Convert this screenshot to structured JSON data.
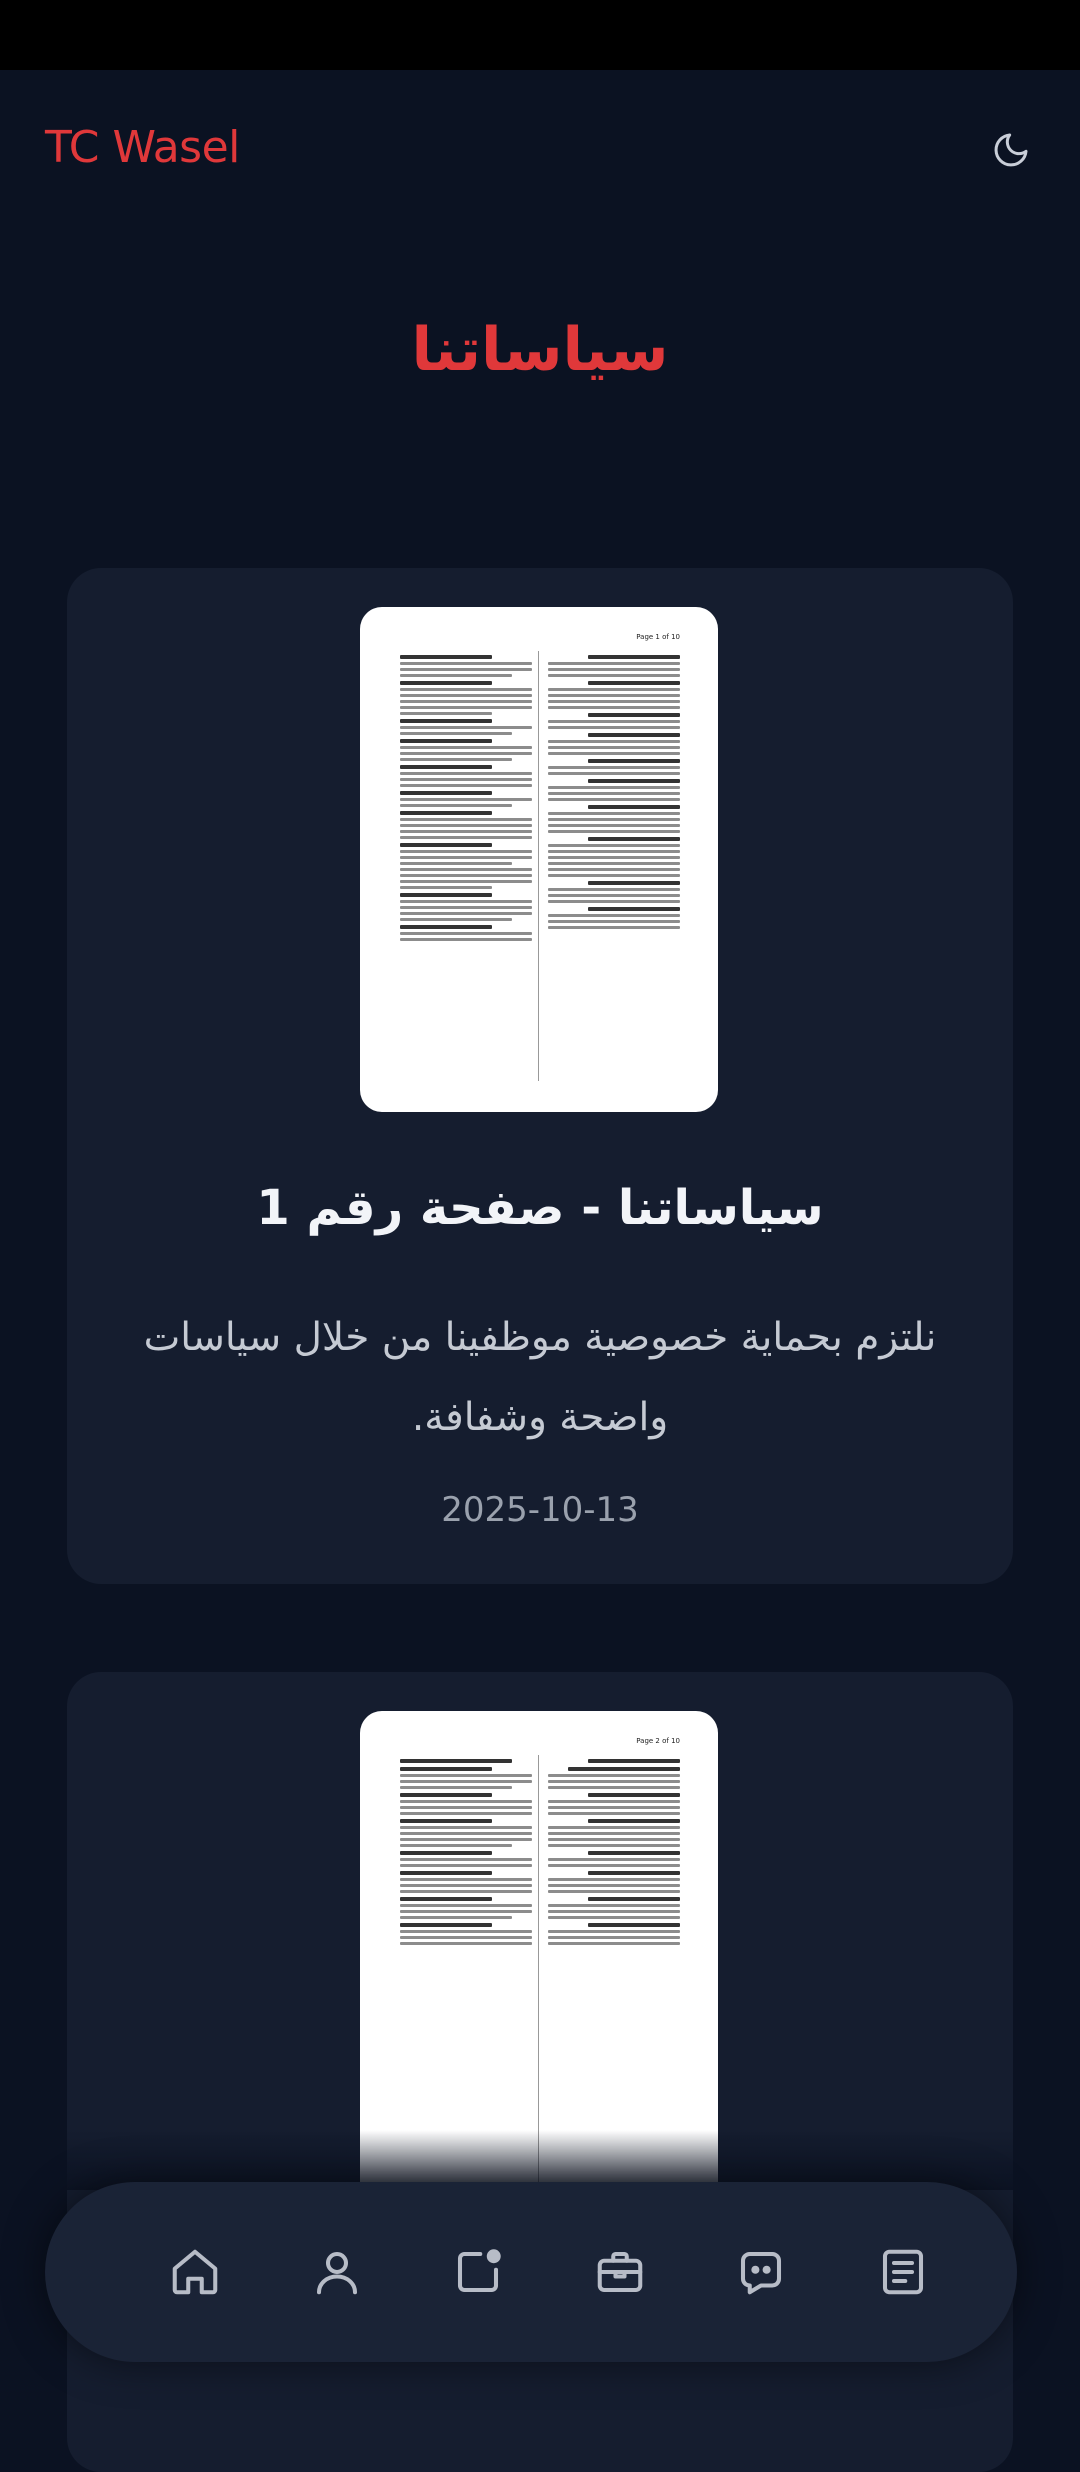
{
  "header": {
    "brand": "TC Wasel",
    "theme_icon": "moon-icon"
  },
  "page": {
    "title": "سياساتنا"
  },
  "cards": [
    {
      "title": "سياساتنا - صفحة رقم 1",
      "description": "نلتزم بحماية خصوصية موظفينا من خلال سياسات واضحة وشفافة.",
      "date": "2025-10-13",
      "thumb_page_label": "Page 1 of 10"
    },
    {
      "thumb_page_label": "Page 2 of 10"
    }
  ],
  "bottom_nav": {
    "items": [
      {
        "icon": "home-icon"
      },
      {
        "icon": "user-icon"
      },
      {
        "icon": "notification-edit-icon"
      },
      {
        "icon": "briefcase-icon"
      },
      {
        "icon": "chat-icon"
      },
      {
        "icon": "document-list-icon"
      }
    ]
  },
  "colors": {
    "background": "#0b1222",
    "card": "#151d2f",
    "accent": "#e0383a",
    "nav": "#1a2336"
  }
}
